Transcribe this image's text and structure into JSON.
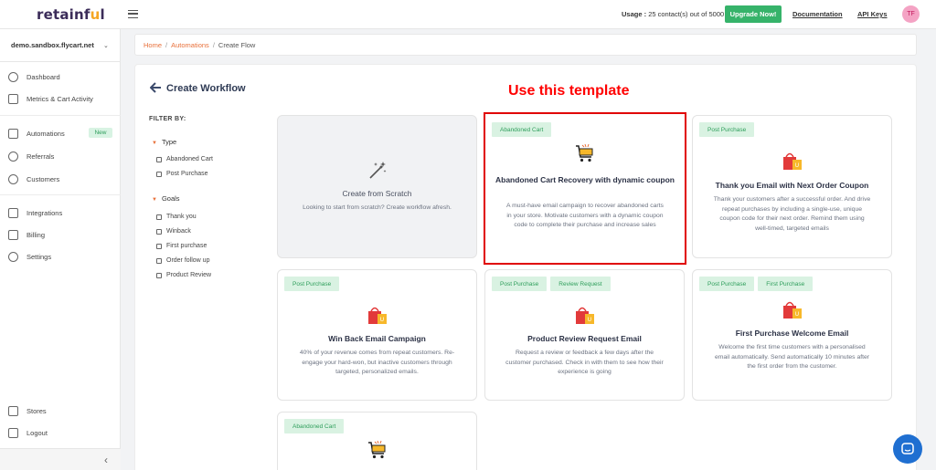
{
  "header": {
    "logo_text": "retainf",
    "logo_accent": "u",
    "logo_tail": "l",
    "usage_label": "Usage :",
    "usage_value": "25 contact(s) out of 5000",
    "upgrade_label": "Upgrade Now!",
    "documentation_label": "Documentation",
    "api_keys_label": "API Keys",
    "avatar_initials": "TF"
  },
  "sidebar": {
    "store_name": "demo.sandbox.flycart.net",
    "store_caret": "⌄",
    "items": [
      {
        "label": "Dashboard",
        "icon": "dashboard-icon"
      },
      {
        "label": "Metrics & Cart Activity",
        "icon": "metrics-icon"
      },
      {
        "label": "Automations",
        "icon": "automations-icon",
        "badge": "New"
      },
      {
        "label": "Referrals",
        "icon": "referrals-icon"
      },
      {
        "label": "Customers",
        "icon": "customers-icon"
      },
      {
        "label": "Integrations",
        "icon": "integrations-icon"
      },
      {
        "label": "Billing",
        "icon": "billing-icon"
      },
      {
        "label": "Settings",
        "icon": "settings-icon"
      },
      {
        "label": "Stores",
        "icon": "stores-icon"
      },
      {
        "label": "Logout",
        "icon": "logout-icon"
      }
    ],
    "collapse_glyph": "‹"
  },
  "breadcrumb": {
    "home": "Home",
    "automations": "Automations",
    "current": "Create Flow",
    "sep": "/"
  },
  "page": {
    "title": "Create Workflow",
    "back_glyph": "🡐",
    "annotation": "Use this template"
  },
  "filters": {
    "title": "FILTER BY:",
    "type_label": "Type",
    "type_options": [
      "Abandoned Cart",
      "Post Purchase"
    ],
    "goals_label": "Goals",
    "goal_options": [
      "Thank you",
      "Winback",
      "First purchase",
      "Order follow up",
      "Product Review"
    ]
  },
  "cards": [
    {
      "title": "Create from Scratch",
      "desc": "Looking to start from scratch? Create workflow afresh."
    },
    {
      "tags": [
        "Abandoned Cart"
      ],
      "title": "Abandoned Cart Recovery with dynamic coupon",
      "desc": "A must-have email campaign to recover abandoned carts in your store. Motivate customers with a dynamic coupon code to complete their purchase and increase sales"
    },
    {
      "tags": [
        "Post Purchase"
      ],
      "title": "Thank you Email with Next Order Coupon",
      "desc": "Thank your customers after a successful order. And drive repeat purchases by including a single-use, unique coupon code for their next order. Remind them using well-timed, targeted emails"
    },
    {
      "tags": [
        "Post Purchase"
      ],
      "title": "Win Back Email Campaign",
      "desc": "40% of your revenue comes from repeat customers. Re-engage your hard-won, but inactive customers through targeted, personalized emails."
    },
    {
      "tags": [
        "Post Purchase",
        "Review Request"
      ],
      "title": "Product Review Request Email",
      "desc": "Request a review or feedback a few days after the customer purchased. Check in with them to see how their experience is going"
    },
    {
      "tags": [
        "Post Purchase",
        "First Purchase"
      ],
      "title": "First Purchase Welcome Email",
      "desc": "Welcome the first time customers with a personalised email automatically. Send automatically 10 minutes after the first order from the customer."
    },
    {
      "tags": [
        "Abandoned Cart"
      ]
    }
  ],
  "colors": {
    "accent_orange": "#e8703a",
    "brand_green": "#36b36a",
    "highlight_red": "#e00000",
    "tag_green_bg": "#d9f2e2"
  }
}
